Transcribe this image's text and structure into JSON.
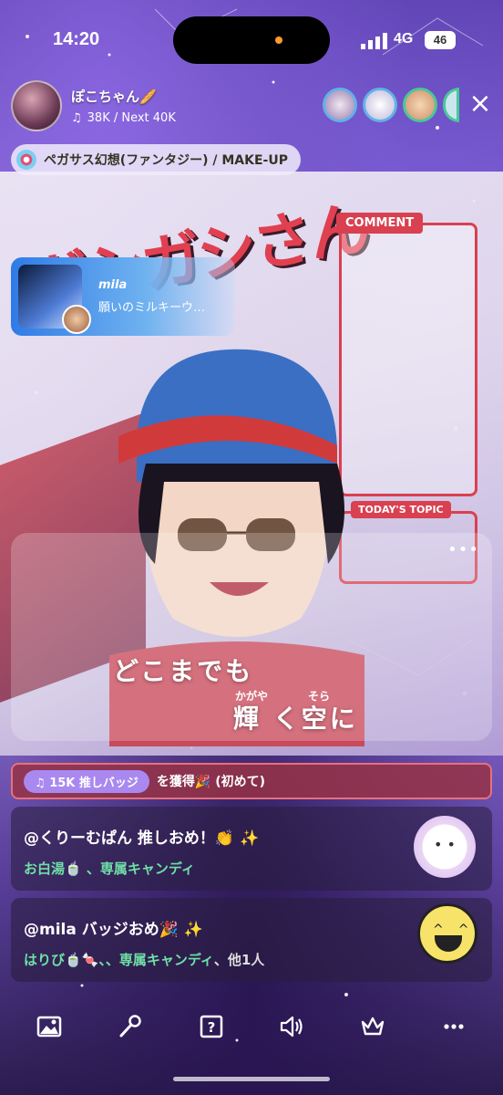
{
  "status_bar": {
    "time": "14:20",
    "network": "4G",
    "battery": "46"
  },
  "host": {
    "name": "ぽこちゃん🥖",
    "level": "38K / Next 40K"
  },
  "song": {
    "title": "ペガサス幻想(ファンタジー) / MAKE-UP"
  },
  "stage": {
    "title_art": "ガシガシさん",
    "comment_label": "COMMENT",
    "topic_label": "TODAY'S TOPIC"
  },
  "music_card": {
    "user": "mila",
    "song": "願いのミルキーウ…"
  },
  "lyrics": {
    "line1": "どこまでも",
    "line2": "輝 く空に",
    "ruby1": "かがや",
    "ruby2": "そら"
  },
  "badge": {
    "chip": "15K 推しバッジ",
    "text": "を獲得🎉 (初めて)"
  },
  "comments": [
    {
      "title": "@くりーむぱん 推しおめ！👏 ✨",
      "items_green": "お白湯🍵 、専属キャンディ",
      "items_rest": ""
    },
    {
      "title": "@mila バッジおめ🎉 ✨",
      "items_green": "はりび🍵🍬、、専属キャンディ",
      "items_rest": "、他1人"
    }
  ],
  "toolbar": {
    "icons": [
      "image-icon",
      "microphone-icon",
      "question-card-icon",
      "speaker-icon",
      "crown-icon",
      "more-icon"
    ]
  }
}
